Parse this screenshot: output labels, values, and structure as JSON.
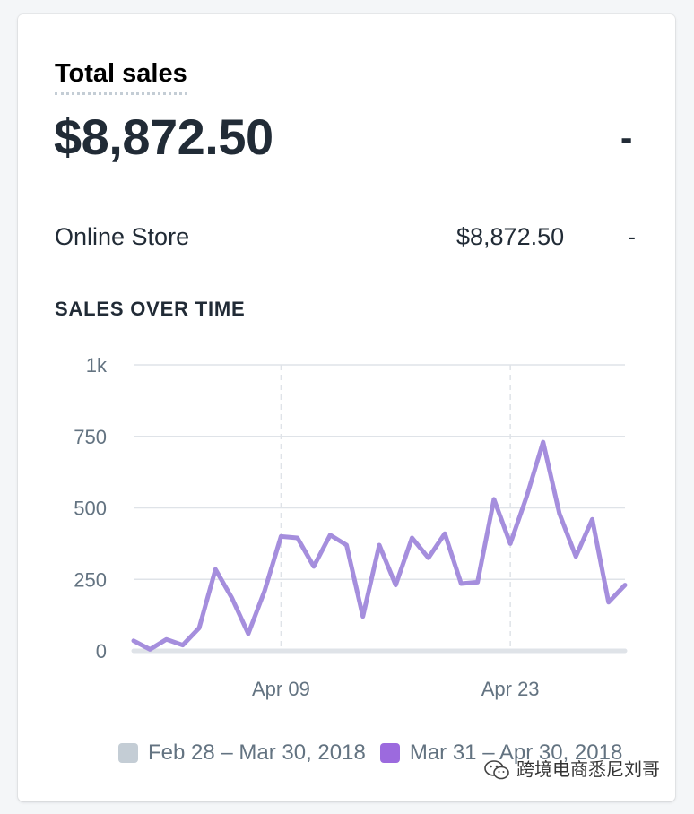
{
  "card": {
    "title": "Total sales",
    "total_value": "$8,872.50",
    "total_change": "-",
    "breakdown": [
      {
        "label": "Online Store",
        "value": "$8,872.50",
        "change": "-"
      }
    ],
    "section_title": "SALES OVER TIME"
  },
  "legend": {
    "previous": "Feb 28 – Mar 30, 2018",
    "current": "Mar 31 – Apr 30, 2018"
  },
  "colors": {
    "current_series": "#a58edd",
    "current_swatch": "#9c6ade",
    "previous_series": "#dfe3e8",
    "previous_swatch": "#c4cdd5",
    "grid": "#dfe3e8",
    "axis_text": "#637381"
  },
  "watermark": {
    "text": "跨境电商悉尼刘哥",
    "icon": "wechat-icon"
  },
  "chart_data": {
    "type": "line",
    "title": "",
    "xlabel": "",
    "ylabel": "",
    "ylim": [
      0,
      1000
    ],
    "yticks": [
      "0",
      "250",
      "500",
      "750",
      "1k"
    ],
    "ytick_values": [
      0,
      250,
      500,
      750,
      1000
    ],
    "x": [
      "Mar 31",
      "Apr 01",
      "Apr 02",
      "Apr 03",
      "Apr 04",
      "Apr 05",
      "Apr 06",
      "Apr 07",
      "Apr 08",
      "Apr 09",
      "Apr 10",
      "Apr 11",
      "Apr 12",
      "Apr 13",
      "Apr 14",
      "Apr 15",
      "Apr 16",
      "Apr 17",
      "Apr 18",
      "Apr 19",
      "Apr 20",
      "Apr 21",
      "Apr 22",
      "Apr 23",
      "Apr 24",
      "Apr 25",
      "Apr 26",
      "Apr 27",
      "Apr 28",
      "Apr 29",
      "Apr 30"
    ],
    "xticks": [
      "Apr 09",
      "Apr 23"
    ],
    "grid": true,
    "legend_position": "bottom",
    "series": [
      {
        "name": "Feb 28 – Mar 30, 2018",
        "values": [
          0,
          0,
          0,
          0,
          0,
          0,
          0,
          0,
          0,
          0,
          0,
          0,
          0,
          0,
          0,
          0,
          0,
          0,
          0,
          0,
          0,
          0,
          0,
          0,
          0,
          0,
          0,
          0,
          0,
          0,
          0
        ]
      },
      {
        "name": "Mar 31 – Apr 30, 2018",
        "values": [
          35,
          5,
          40,
          20,
          80,
          285,
          185,
          60,
          210,
          400,
          395,
          295,
          405,
          370,
          120,
          370,
          230,
          395,
          325,
          410,
          235,
          240,
          530,
          375,
          540,
          730,
          480,
          330,
          460,
          170,
          230
        ]
      }
    ]
  }
}
